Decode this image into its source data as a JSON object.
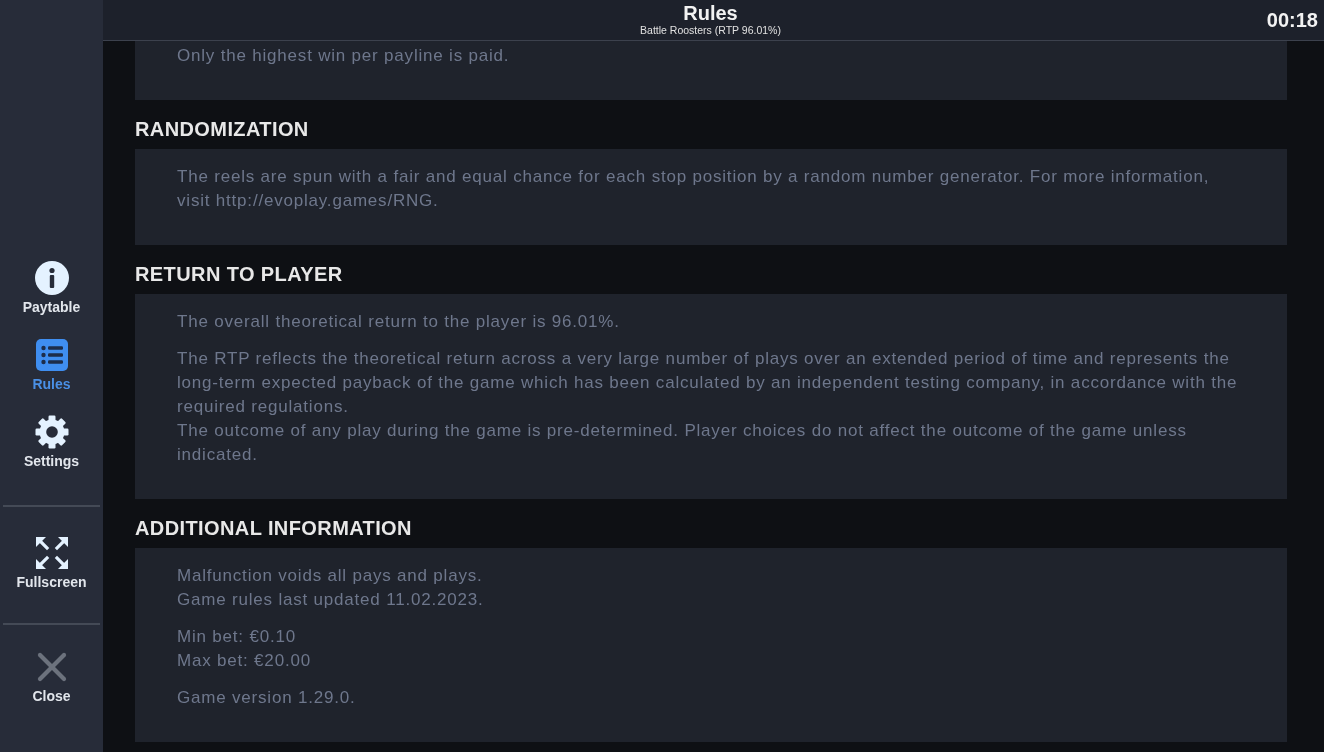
{
  "header": {
    "title": "Rules",
    "subtitle": "Battle Roosters (RTP 96.01%)",
    "timer": "00:18"
  },
  "sidebar": {
    "tabs": [
      {
        "label": "Paytable",
        "selected": false
      },
      {
        "label": "Rules",
        "selected": true
      },
      {
        "label": "Settings",
        "selected": false
      }
    ],
    "actions": [
      {
        "label": "Fullscreen"
      },
      {
        "label": "Close"
      }
    ]
  },
  "sections": [
    {
      "groups": [
        [
          "Only the highest win per payline is paid."
        ]
      ]
    },
    {
      "heading": "RANDOMIZATION",
      "groups": [
        [
          "The reels are spun with a fair and equal chance for each stop position by a random number generator. For more information, visit http://evoplay.games/RNG."
        ]
      ]
    },
    {
      "heading": "RETURN TO PLAYER",
      "groups": [
        [
          "The overall theoretical return to the player is 96.01%."
        ],
        [
          "The RTP reflects the theoretical return across a very large number of plays over an extended period of time and represents the long-term expected payback of the game which has been calculated by an independent testing company, in accordance with the required regulations.",
          "The outcome of any play during the game is pre-determined. Player choices do not affect the outcome of the game unless indicated."
        ]
      ]
    },
    {
      "heading": "ADDITIONAL INFORMATION",
      "groups": [
        [
          "Malfunction voids all pays and plays.",
          "Game rules last updated 11.02.2023."
        ],
        [
          "Min bet: €0.10",
          "Max bet: €20.00"
        ],
        [
          "Game version 1.29.0."
        ]
      ]
    }
  ]
}
